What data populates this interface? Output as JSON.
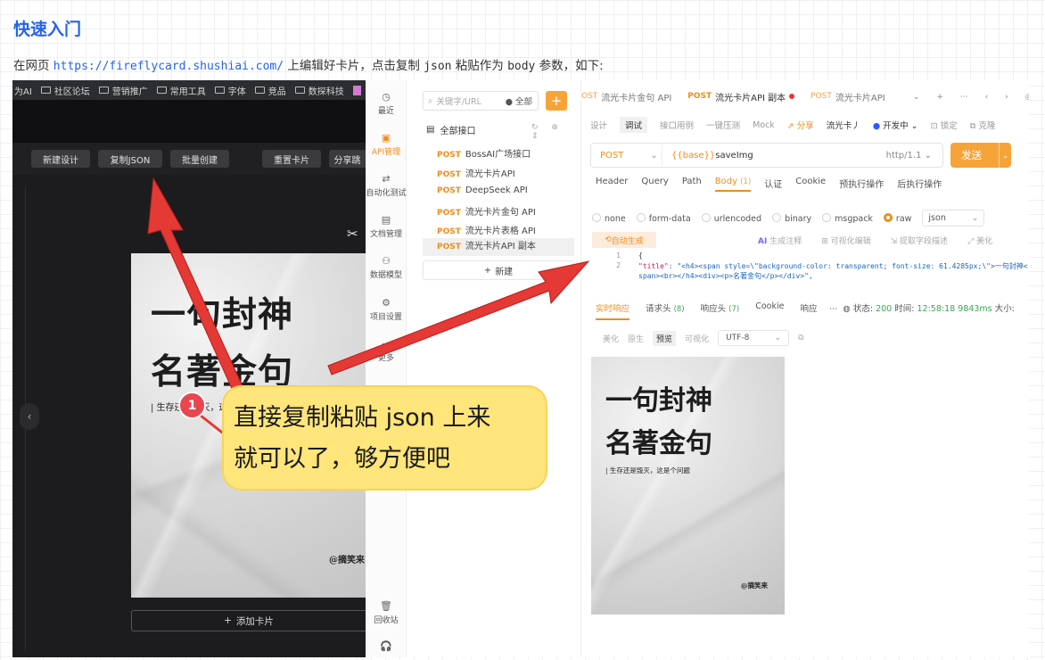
{
  "doc": {
    "title": "快速入门",
    "intro_prefix": "在网页 ",
    "intro_link": "https://fireflycard.shushiai.com/",
    "intro_suffix_1": " 上编辑好卡片，点击复制 ",
    "intro_code_json": "json",
    "intro_suffix_2": " 粘贴作为 ",
    "intro_code_body": "body",
    "intro_suffix_3": " 参数，如下:"
  },
  "browser": {
    "bookmarks": [
      "为AI",
      "社区论坛",
      "营销推广",
      "常用工具",
      "字体",
      "竞品",
      "数探科技"
    ]
  },
  "editor": {
    "toolbar": [
      "新建设计",
      "复制JSON",
      "批量创建",
      "重置卡片",
      "分享跳"
    ],
    "collapse_icon": "‹",
    "scissor_icon": "✂",
    "card": {
      "line1": "一句封神",
      "line2": "名著金句",
      "subtitle": "| 生存还是毁灭，这是个问题",
      "signature": "@摘笑来"
    },
    "add_card_label": "添加卡片"
  },
  "nav": {
    "items": [
      {
        "icon": "◷",
        "label": "最近"
      },
      {
        "icon": "▣",
        "label": "API管理"
      },
      {
        "icon": "⇄",
        "label": "自动化测试"
      },
      {
        "icon": "▤",
        "label": "文档管理"
      },
      {
        "icon": "⚇",
        "label": "数据模型"
      },
      {
        "icon": "⚙",
        "label": "项目设置"
      },
      {
        "icon": "⋯",
        "label": "更多"
      }
    ],
    "trash": {
      "icon": "🗑",
      "label": "回收站"
    },
    "support_icon": "🎧"
  },
  "tree": {
    "search_placeholder": "关键字/URL",
    "scope_label": "● 全部",
    "root_label": "全部接口",
    "items": [
      {
        "method": "POST",
        "name": "BossAI广场接口"
      },
      {
        "method": "POST",
        "name": "流光卡片API"
      },
      {
        "method": "POST",
        "name": "DeepSeek API"
      },
      {
        "method": "POST",
        "name": "流光卡片金句 API"
      },
      {
        "method": "POST",
        "name": "流光卡片表格 API"
      },
      {
        "method": "POST",
        "name": "流光卡片API 副本"
      }
    ],
    "new_label": "新建"
  },
  "tabs": [
    {
      "method": "POST",
      "name": "流光卡片金句 API",
      "prefix": "OST"
    },
    {
      "method": "POST",
      "name": "流光卡片API 副本"
    },
    {
      "method": "POST",
      "name": "流光卡片API"
    }
  ],
  "tab_controls": "⌄ + ⋯ ‹ › ◎ 新",
  "subtabs": {
    "design": "设计",
    "debug": "调试",
    "case": "接口用例",
    "stress": "一键压测",
    "mock": "Mock",
    "share": "分享",
    "doc_name": "流光卡丿",
    "env": "开发中",
    "lock": "锁定",
    "clone": "克隆"
  },
  "request": {
    "method": "POST",
    "url_base": "{{base}}",
    "url_path": "saveImg",
    "version": "http/1.1",
    "send_label": "发送"
  },
  "req_tabs": [
    "Header",
    "Query",
    "Path",
    "Body",
    "认证",
    "Cookie",
    "预执行操作",
    "后执行操作"
  ],
  "body_count": "(1)",
  "body_types": [
    "none",
    "form-data",
    "urlencoded",
    "binary",
    "msgpack",
    "raw"
  ],
  "raw_format": "json",
  "body_tools": {
    "autogen": "自动生成",
    "ai_gen": "生成注释",
    "visual": "可视化编辑",
    "extract": "提取字段描述",
    "beautify": "美化"
  },
  "code": {
    "line1_num": "1",
    "line2_num": "2",
    "line1": "{",
    "line2_key": "\"title\"",
    "line2_val": ": \"<h4><span style=\\\"background-color: transparent; font-size: 61.4285px;\\\">一句封神<",
    "line3_val": "span><br></h4><div><p>名著金句</p></div>\","
  },
  "response": {
    "tabs": [
      "实时响应",
      "请求头",
      "响应头",
      "Cookie",
      "响应"
    ],
    "req_header_count": "(8)",
    "resp_header_count": "(7)",
    "status_label": "状态:",
    "status_code": "200",
    "time_label": "时间:",
    "time_value": "12:58:18",
    "duration": "9843ms",
    "size_label": "大小:",
    "view_tabs": [
      "美化",
      "原生",
      "预览",
      "可视化"
    ],
    "encoding": "UTF-8"
  },
  "callout": {
    "badge": "1",
    "line1": "直接复制粘贴 json 上来",
    "line2": "就可以了，够方便吧"
  },
  "colors": {
    "accent": "#f08c1a",
    "link": "#2563eb",
    "callout_bg": "#ffe57a",
    "arrow_red": "#e53935"
  }
}
